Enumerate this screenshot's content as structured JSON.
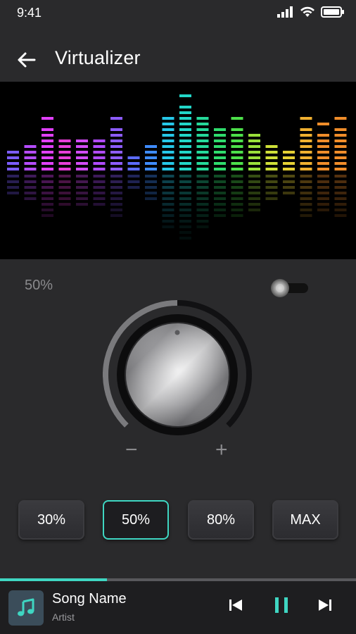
{
  "status_bar": {
    "time": "9:41",
    "icons": [
      "signal-icon",
      "wifi-icon",
      "battery-icon"
    ]
  },
  "app_bar": {
    "title": "Virtualizer",
    "back_icon": "arrow-left-icon"
  },
  "visualizer": {
    "type": "equalizer-spectrum",
    "bar_colors": [
      "#7b5cff",
      "#b54cff",
      "#e040fb",
      "#e83ed8",
      "#d24bf5",
      "#b04bff",
      "#8d5cff",
      "#5c6bff",
      "#3f8cff",
      "#26c7e8",
      "#22d6c8",
      "#25d99a",
      "#2fdc6c",
      "#4de04a",
      "#9ae03a",
      "#cfe038",
      "#e6d034",
      "#f0b030",
      "#f08d2a"
    ]
  },
  "intensity": {
    "label": "50%",
    "level_percent": 50
  },
  "enable_toggle": {
    "on": false
  },
  "knob": {
    "minus_label": "−",
    "plus_label": "+",
    "level_percent": 50
  },
  "presets": [
    {
      "label": "30%",
      "active": false
    },
    {
      "label": "50%",
      "active": true
    },
    {
      "label": "80%",
      "active": false
    },
    {
      "label": "MAX",
      "active": false
    }
  ],
  "player": {
    "song": "Song Name",
    "artist": "Artist",
    "progress_percent": 30,
    "accent": "#3fd6c2",
    "icons": [
      "music-note-icon",
      "skip-previous-icon",
      "pause-icon",
      "skip-next-icon"
    ]
  }
}
